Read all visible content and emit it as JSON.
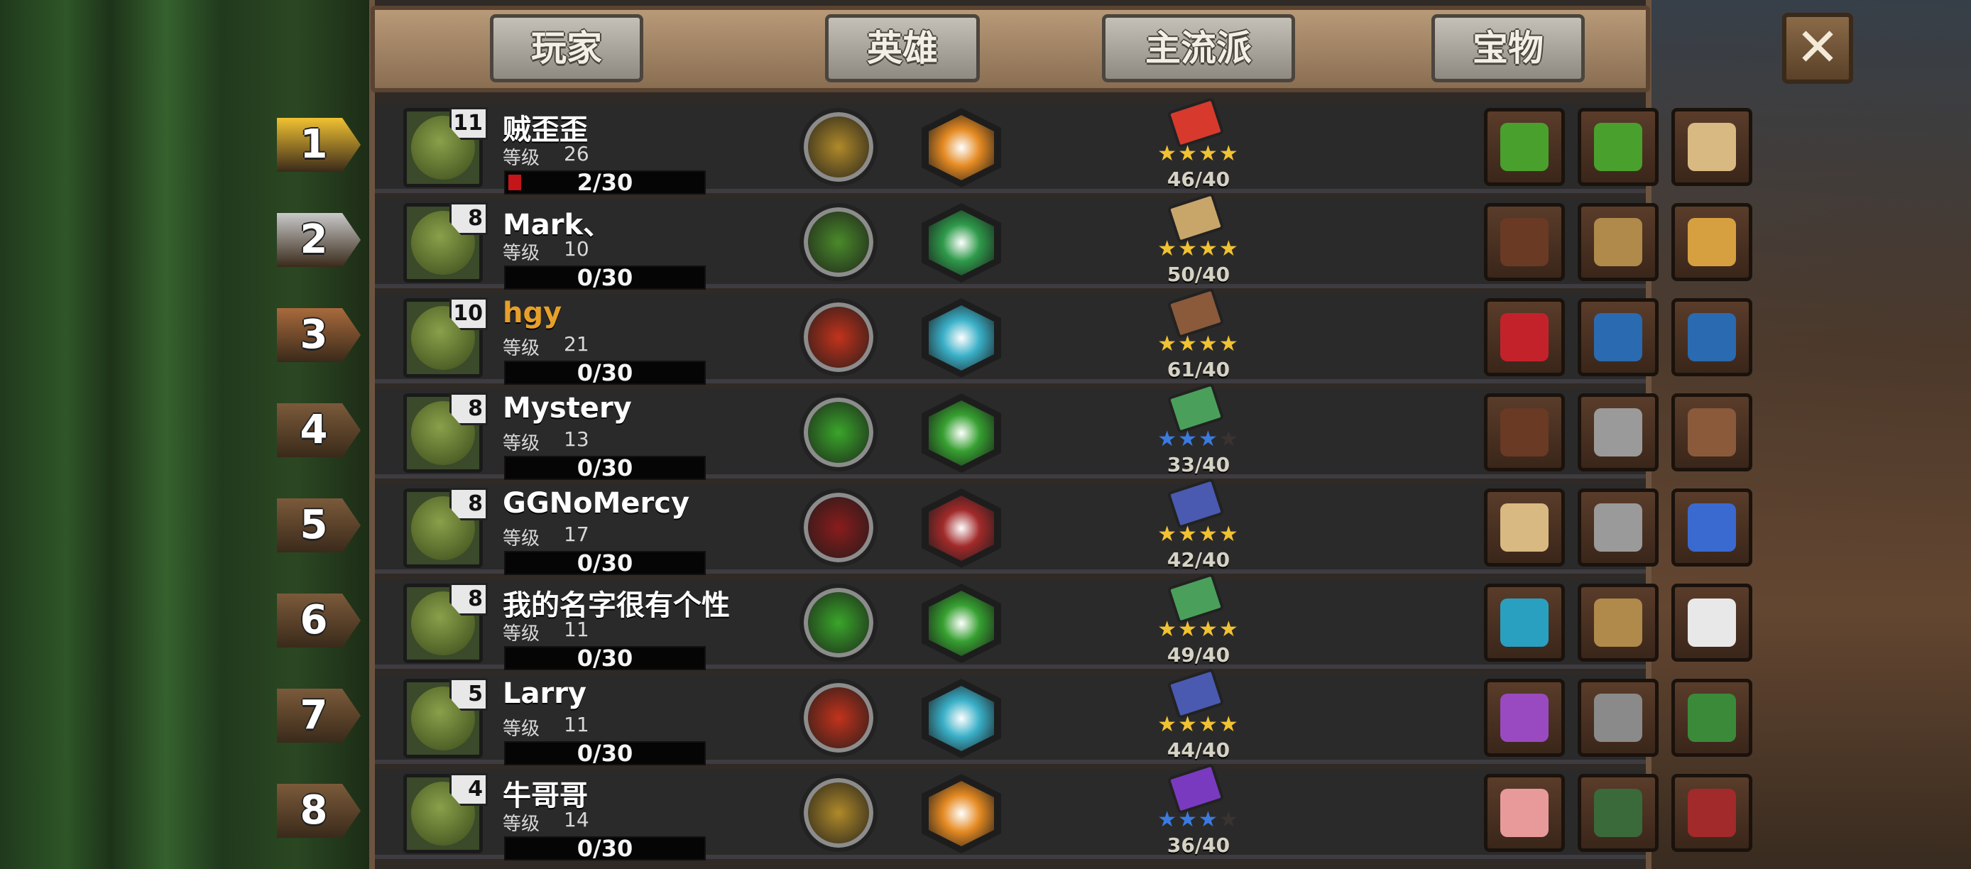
{
  "tabs": [
    "玩家",
    "英雄",
    "主流派",
    "宝物"
  ],
  "close_label": "✕",
  "level_label": "等级",
  "rank_colors": [
    "#f1c232",
    "#c9c9c9",
    "#a86a3c",
    "#7b5a3a",
    "#7b5a3a",
    "#7b5a3a",
    "#7b5a3a",
    "#7b5a3a"
  ],
  "players": [
    {
      "rank": "1",
      "name": "贼歪歪",
      "name_color": "#ffffff",
      "avatar_level": "11",
      "level": "26",
      "progress": "2/30",
      "progress_fraction": 0.067,
      "hero_icon": "gold-coins-icon",
      "hero_color": "#b08a2a",
      "skill_icon": "gold-medal-icon",
      "skill_color": "#e58a22",
      "book_icon": "red-book-icon",
      "book_color": "#d73a2c",
      "stars": [
        "gold",
        "gold",
        "gold",
        "gold"
      ],
      "count": "46/40",
      "treasures": [
        "money-stack-icon",
        "money-stack-icon",
        "treasure-map-scroll-icon"
      ],
      "treasure_colors": [
        "#4aa02c",
        "#4aa02c",
        "#d8b982"
      ]
    },
    {
      "rank": "2",
      "name": "Mark、",
      "name_color": "#ffffff",
      "avatar_level": "8",
      "level": "10",
      "progress": "0/30",
      "progress_fraction": 0,
      "hero_icon": "green-hop-icon",
      "hero_color": "#4a8a2a",
      "skill_icon": "green-magic-icon",
      "skill_color": "#2e9a4a",
      "book_icon": "tan-book-icon",
      "book_color": "#c8a66a",
      "stars": [
        "gold",
        "gold",
        "gold",
        "gold"
      ],
      "count": "50/40",
      "treasures": [
        "leather-vest-icon",
        "scales-icon",
        "gold-nugget-icon"
      ],
      "treasure_colors": [
        "#6a3a24",
        "#b08a4a",
        "#d6a040"
      ]
    },
    {
      "rank": "3",
      "name": "hgy",
      "name_color": "#e6a02a",
      "avatar_level": "10",
      "level": "21",
      "progress": "0/30",
      "progress_fraction": 0,
      "hero_icon": "sword-slash-icon",
      "hero_color": "#c2331c",
      "skill_icon": "ice-burst-icon",
      "skill_color": "#3ab0c8",
      "book_icon": "brown-shield-book-icon",
      "book_color": "#8a5a3a",
      "stars": [
        "gold",
        "gold",
        "gold",
        "gold"
      ],
      "count": "61/40",
      "treasures": [
        "treasure-chest-icon",
        "lantern-icon",
        "lantern-icon"
      ],
      "treasure_colors": [
        "#c4222a",
        "#2a6ab0",
        "#2a6ab0"
      ]
    },
    {
      "rank": "4",
      "name": "Mystery",
      "name_color": "#ffffff",
      "avatar_level": "8",
      "level": "13",
      "progress": "0/30",
      "progress_fraction": 0,
      "hero_icon": "green-slime-icon",
      "hero_color": "#3aa62a",
      "skill_icon": "green-swirl-icon",
      "skill_color": "#36a030",
      "book_icon": "green-skull-book-icon",
      "book_color": "#4aa05a",
      "stars": [
        "blue",
        "blue",
        "blue",
        "off"
      ],
      "count": "33/40",
      "treasures": [
        "leather-vest-icon",
        "skull-ring-icon",
        "meat-cleaver-icon"
      ],
      "treasure_colors": [
        "#6a3a24",
        "#9a9a9a",
        "#8a5a3a"
      ]
    },
    {
      "rank": "5",
      "name": "GGNoMercy",
      "name_color": "#ffffff",
      "avatar_level": "8",
      "level": "17",
      "progress": "0/30",
      "progress_fraction": 0,
      "hero_icon": "red-feather-icon",
      "hero_color": "#8a1c1c",
      "skill_icon": "beast-jaws-icon",
      "skill_color": "#a22a2a",
      "book_icon": "blue-sword-book-icon",
      "book_color": "#4a5ab0",
      "stars": [
        "gold",
        "gold",
        "gold",
        "gold"
      ],
      "count": "42/40",
      "treasures": [
        "star-map-icon",
        "skull-ring-icon",
        "compass-icon"
      ],
      "treasure_colors": [
        "#d8b982",
        "#9a9a9a",
        "#3a6ad0"
      ]
    },
    {
      "rank": "6",
      "name": "我的名字很有个性",
      "name_color": "#ffffff",
      "avatar_level": "8",
      "level": "11",
      "progress": "0/30",
      "progress_fraction": 0,
      "hero_icon": "green-slime-icon",
      "hero_color": "#3aa62a",
      "skill_icon": "green-swirl-icon",
      "skill_color": "#36a030",
      "book_icon": "green-skull-book-icon",
      "book_color": "#4aa05a",
      "stars": [
        "gold",
        "gold",
        "gold",
        "gold"
      ],
      "count": "49/40",
      "treasures": [
        "magic-staff-icon",
        "scales-icon",
        "playing-cards-icon"
      ],
      "treasure_colors": [
        "#2aa0c0",
        "#b08a4a",
        "#e8e8e8"
      ]
    },
    {
      "rank": "7",
      "name": "Larry",
      "name_color": "#ffffff",
      "avatar_level": "5",
      "level": "11",
      "progress": "0/30",
      "progress_fraction": 0,
      "hero_icon": "sword-slash-icon",
      "hero_color": "#c2331c",
      "skill_icon": "ice-burst-icon",
      "skill_color": "#3ab0c8",
      "book_icon": "blue-sword-book-icon",
      "book_color": "#4a5ab0",
      "stars": [
        "gold",
        "gold",
        "gold",
        "gold"
      ],
      "count": "44/40",
      "treasures": [
        "potion-bottle-icon",
        "bookshelf-icon",
        "green-book-icon"
      ],
      "treasure_colors": [
        "#9a4ac0",
        "#8a8a8a",
        "#3a8a3a"
      ]
    },
    {
      "rank": "8",
      "name": "牛哥哥",
      "name_color": "#ffffff",
      "avatar_level": "4",
      "level": "14",
      "progress": "0/30",
      "progress_fraction": 0,
      "hero_icon": "gold-coins-icon",
      "hero_color": "#b08a2a",
      "skill_icon": "gold-medal-icon",
      "skill_color": "#e58a22",
      "book_icon": "purple-skull-book-icon",
      "book_color": "#7a3ac0",
      "stars": [
        "blue",
        "blue",
        "blue",
        "off"
      ],
      "count": "36/40",
      "treasures": [
        "piggy-bank-icon",
        "flame-orb-icon",
        "red-rocket-icon"
      ],
      "treasure_colors": [
        "#e89a9a",
        "#3a6a3a",
        "#a22a2a"
      ]
    }
  ]
}
